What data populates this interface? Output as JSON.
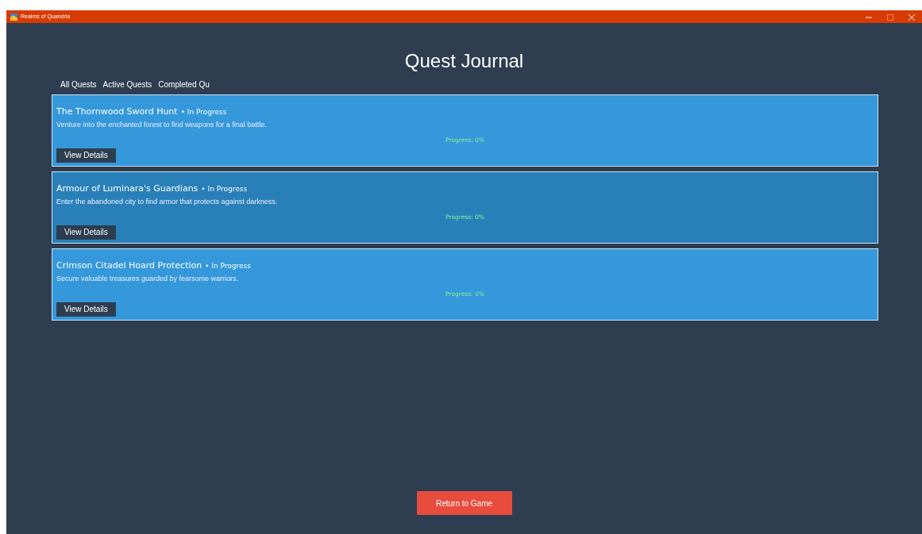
{
  "window": {
    "title": "Realms of Quandria",
    "maximize_disabled": true
  },
  "heading": "Quest Journal",
  "tabs": [
    {
      "label": "All Quests"
    },
    {
      "label": "Active Quests"
    },
    {
      "label": "Completed Qu"
    }
  ],
  "quests": [
    {
      "title": "The Thornwood Sword Hunt",
      "status": "• In Progress",
      "description": "Venture into the enchanted forest to find weapons for a final battle.",
      "progress": "Progress: 0%",
      "button": "View Details",
      "hovered": false
    },
    {
      "title": "Armour of Luminara's Guardians",
      "status": "• In Progress",
      "description": "Enter the abandoned city to find armor that protects against darkness.",
      "progress": "Progress: 0%",
      "button": "View Details",
      "hovered": true
    },
    {
      "title": "Crimson Citadel Hoard Protection",
      "status": "• In Progress",
      "description": "Secure valuable treasures guarded by fearsome warriors.",
      "progress": "Progress: 0%",
      "button": "View Details",
      "hovered": false
    }
  ],
  "return_button": "Return to Game"
}
